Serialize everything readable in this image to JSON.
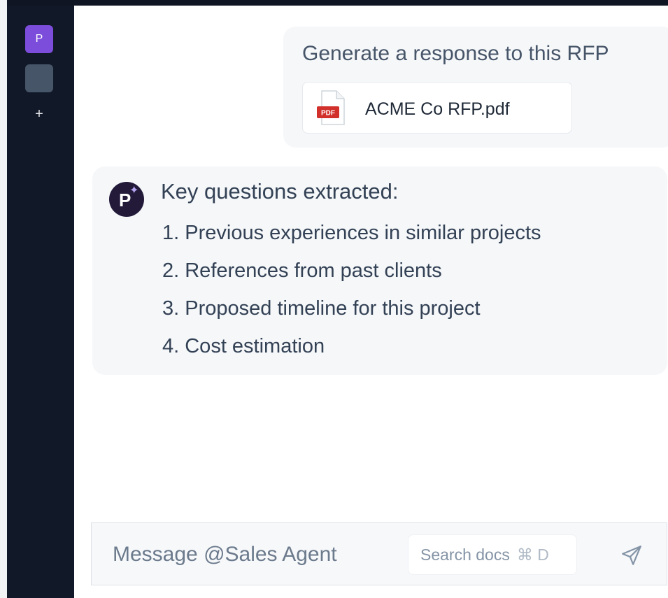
{
  "sidebar": {
    "workspace_initial": "P",
    "add_label": "+"
  },
  "conversation": {
    "user_message": {
      "text": "Generate a response to this RFP",
      "attachment": {
        "type_label": "PDF",
        "filename": "ACME Co RFP.pdf"
      }
    },
    "assistant_message": {
      "avatar_initial": "P",
      "heading": "Key questions extracted:",
      "items": [
        "1. Previous experiences in similar projects",
        "2. References from past clients",
        "3. Proposed timeline for this project",
        "4. Cost estimation"
      ]
    }
  },
  "composer": {
    "placeholder": "Message @Sales Agent",
    "search_label": "Search docs",
    "search_shortcut": "⌘ D"
  },
  "icons": {
    "attachment": "pdf-file-icon",
    "avatar": "sparkle-icon",
    "send": "send-icon"
  },
  "colors": {
    "sidebar_bg": "#111827",
    "workspace_accent": "#7c4ddb",
    "pdf_red": "#d1302b",
    "bubble_bg": "#f5f7f9"
  }
}
